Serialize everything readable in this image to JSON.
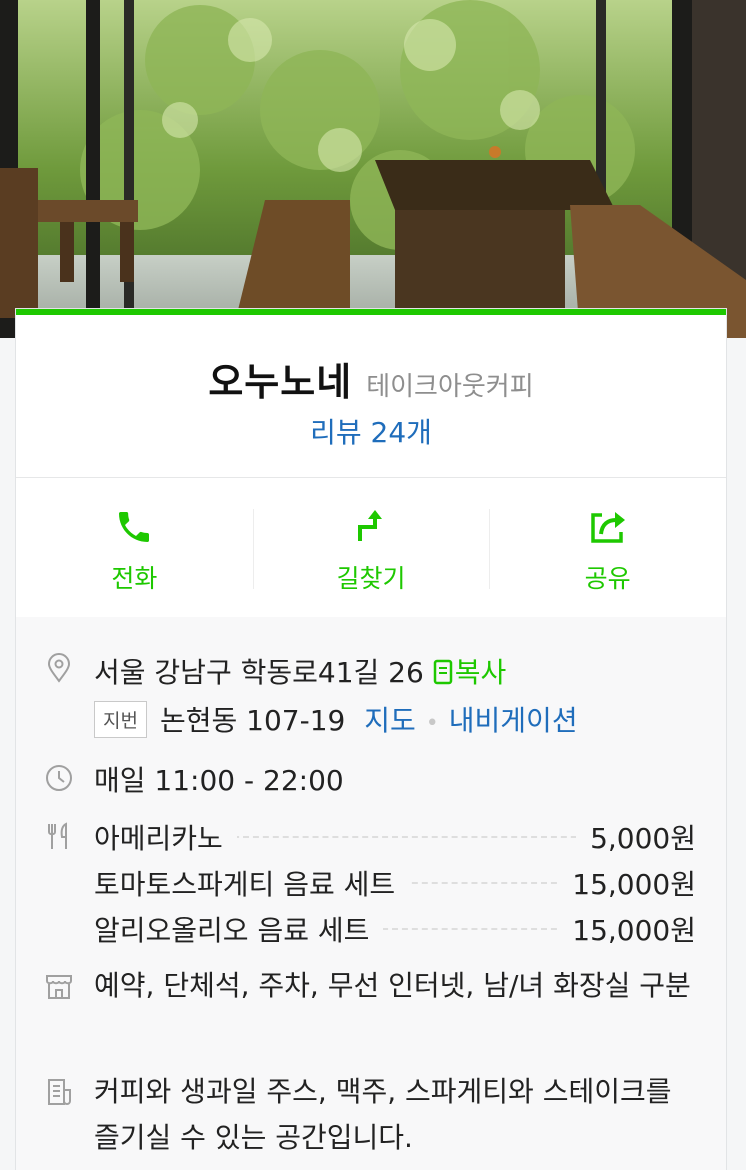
{
  "place": {
    "name": "오누노네",
    "category": "테이크아웃커피",
    "review_link": "리뷰 24개"
  },
  "actions": [
    {
      "label": "전화",
      "icon": "phone-icon"
    },
    {
      "label": "길찾기",
      "icon": "directions-icon"
    },
    {
      "label": "공유",
      "icon": "share-icon"
    }
  ],
  "address": {
    "road": "서울 강남구 학동로41길 26",
    "copy_label": "복사",
    "jibun_tag": "지번",
    "jibun": "논현동 107-19",
    "map_link": "지도",
    "nav_link": "내비게이션"
  },
  "hours": "매일 11:00 - 22:00",
  "menu": [
    {
      "name": "아메리카노",
      "price": "5,000원"
    },
    {
      "name": "토마토스파게티 음료 세트",
      "price": "15,000원"
    },
    {
      "name": "알리오올리오 음료 세트",
      "price": "15,000원"
    }
  ],
  "facilities": "예약, 단체석, 주차, 무선 인터넷, 남/녀 화장실 구분",
  "description": "커피와 생과일 주스, 맥주, 스파게티와 스테이크를 즐기실 수 있는 공간입니다.",
  "colors": {
    "accent": "#1ec800",
    "link": "#1f6dbb",
    "category": "#8e8e8e"
  }
}
